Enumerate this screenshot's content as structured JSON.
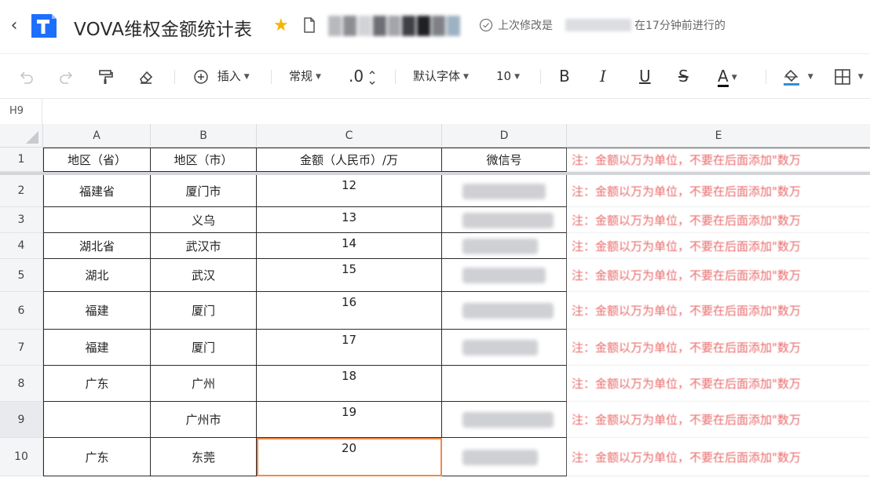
{
  "titlebar": {
    "title": "VOVA维权金额统计表",
    "back_symbol": "‹",
    "star_symbol": "★",
    "save_prefix": "上次修改是",
    "save_time": "在17分钟前进行的",
    "accent": "#1a73e8",
    "star_color": "#f5b400"
  },
  "toolbar": {
    "insert_label": "插入",
    "format_label": "常规",
    "decimal_label": ".0",
    "font_label": "默认字体",
    "size_label": "10",
    "bold": "B",
    "italic": "I",
    "underline": "U",
    "strike": "S",
    "font_color": "A"
  },
  "namebox": {
    "ref": "H9"
  },
  "columns": [
    "A",
    "B",
    "C",
    "D",
    "E"
  ],
  "rows": [
    {
      "num": "1",
      "a": "地区（省）",
      "b": "地区（市）",
      "c": "金额（人民币）/万",
      "d": "微信号"
    },
    {
      "num": "2",
      "a": "福建省",
      "b": "厦门市",
      "c": "12"
    },
    {
      "num": "3",
      "a": "",
      "b": "义乌",
      "c": "13"
    },
    {
      "num": "4",
      "a": "湖北省",
      "b": "武汉市",
      "c": "14"
    },
    {
      "num": "5",
      "a": "湖北",
      "b": "武汉",
      "c": "15"
    },
    {
      "num": "6",
      "a": "福建",
      "b": "厦门",
      "c": "16"
    },
    {
      "num": "7",
      "a": "福建",
      "b": "厦门",
      "c": "17"
    },
    {
      "num": "8",
      "a": "广东",
      "b": "广州",
      "c": "18"
    },
    {
      "num": "9",
      "a": "",
      "b": "广州市",
      "c": "19"
    },
    {
      "num": "10",
      "a": "广东",
      "b": "东莞",
      "c": "20"
    }
  ],
  "note": "注：金额以万为单位，不要在后面添加\"数万",
  "note_color": "#e85a5a",
  "active_cell_color": "#f08a4b"
}
